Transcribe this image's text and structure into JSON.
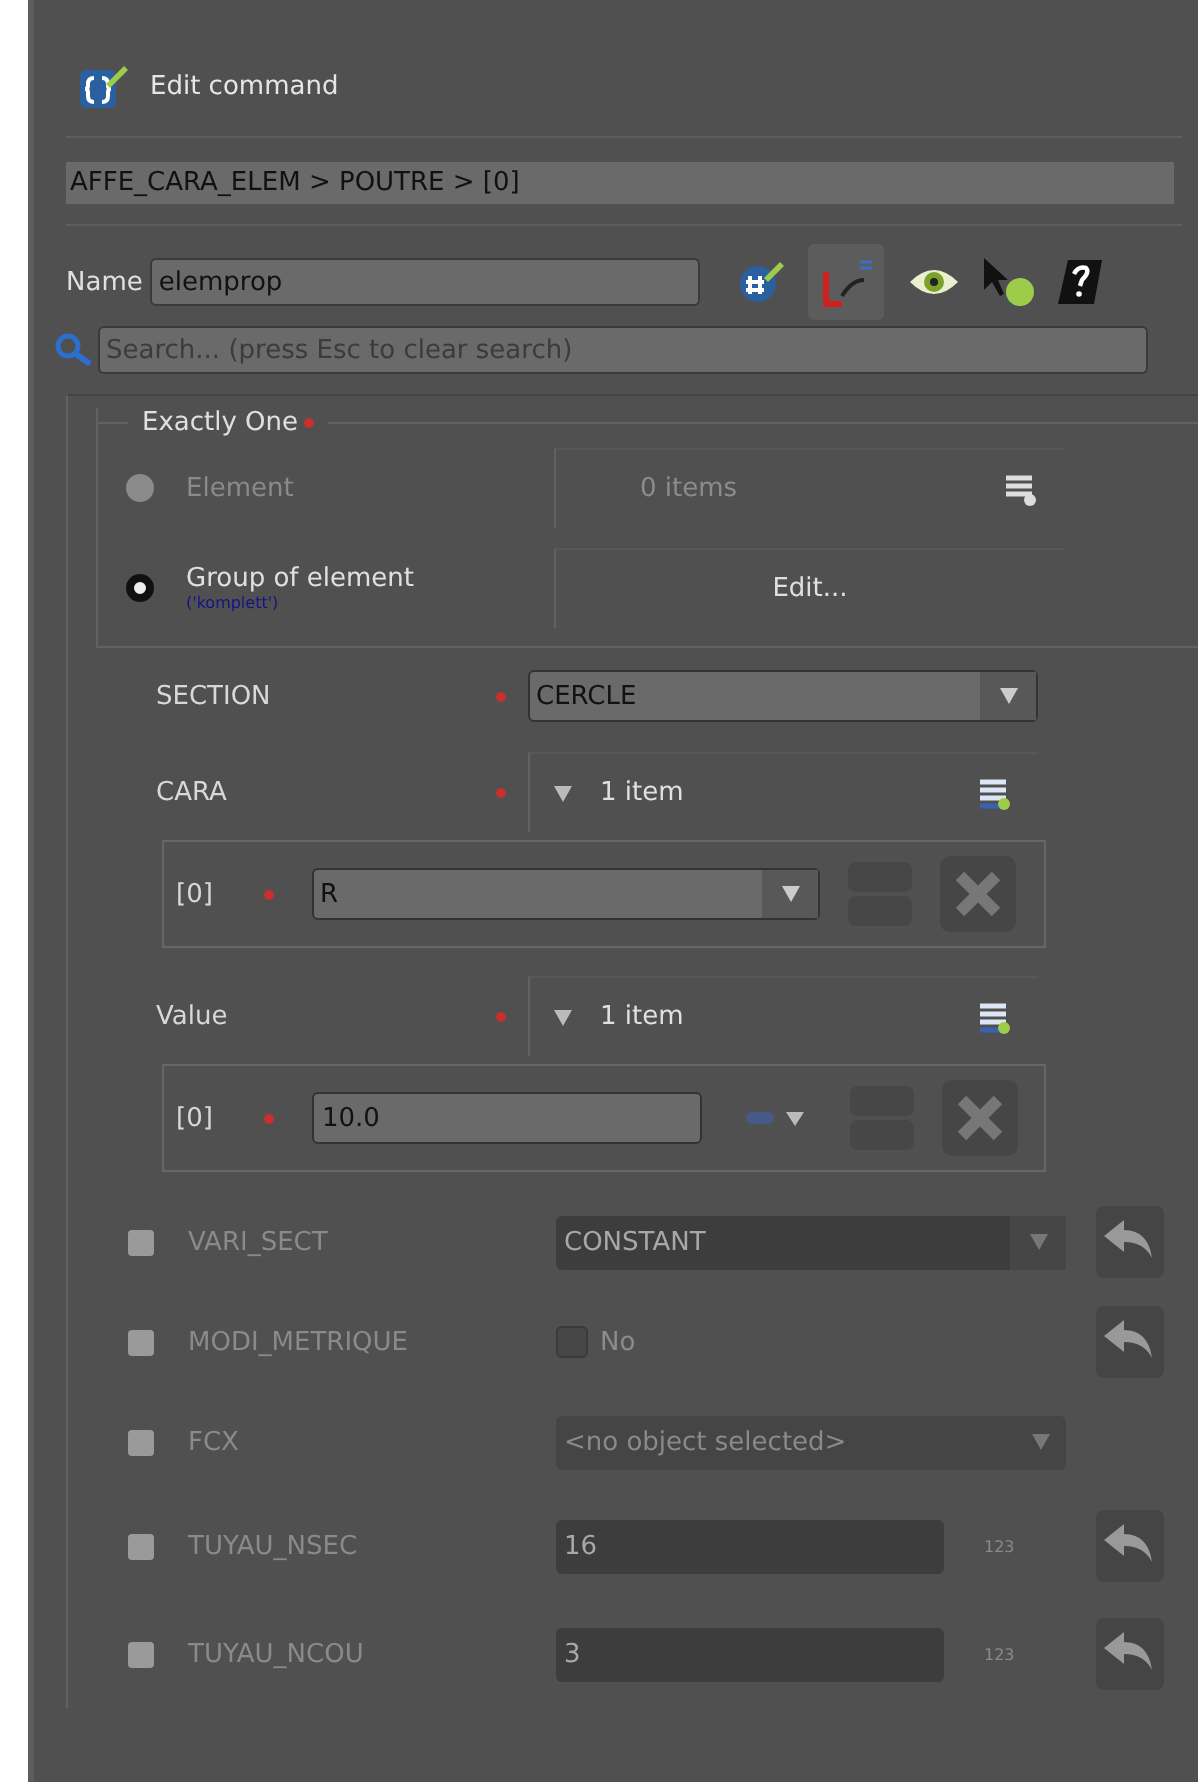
{
  "window": {
    "title": "Edit command"
  },
  "breadcrumb": "AFFE_CARA_ELEM > POUTRE > [0]",
  "name": {
    "label": "Name",
    "value": "elemprop"
  },
  "search": {
    "placeholder": "Search... (press Esc to clear search)"
  },
  "group": {
    "title": "Exactly One",
    "required": true,
    "options": [
      {
        "label": "Element",
        "selected": false,
        "disabled": true,
        "control": {
          "kind": "list",
          "text": "0 items"
        }
      },
      {
        "label": "Group of element",
        "sublabel": "('komplett')",
        "selected": true,
        "disabled": false,
        "control": {
          "kind": "button",
          "text": "Edit..."
        }
      }
    ]
  },
  "fields": [
    {
      "kind": "combo",
      "label": "SECTION",
      "required": true,
      "value": "CERCLE"
    },
    {
      "kind": "list",
      "label": "CARA",
      "required": true,
      "summary": "1 item",
      "items": [
        {
          "kind": "combo",
          "index": "[0]",
          "required": true,
          "value": "R"
        }
      ]
    },
    {
      "kind": "list",
      "label": "Value",
      "required": true,
      "summary": "1 item",
      "items": [
        {
          "kind": "number",
          "index": "[0]",
          "required": true,
          "value": "10.0"
        }
      ]
    }
  ],
  "optional": [
    {
      "kind": "combo",
      "label": "VARI_SECT",
      "checked": false,
      "value": "CONSTANT",
      "undo": true
    },
    {
      "kind": "bool",
      "label": "MODI_METRIQUE",
      "checked": false,
      "value": "No",
      "on": false,
      "undo": true
    },
    {
      "kind": "select",
      "label": "FCX",
      "checked": false,
      "value": "<no object selected>",
      "undo": false
    },
    {
      "kind": "number",
      "label": "TUYAU_NSEC",
      "checked": false,
      "value": "16",
      "hint": "123",
      "undo": true
    },
    {
      "kind": "number",
      "label": "TUYAU_NCOU",
      "checked": false,
      "value": "3",
      "hint": "123",
      "undo": true
    }
  ]
}
